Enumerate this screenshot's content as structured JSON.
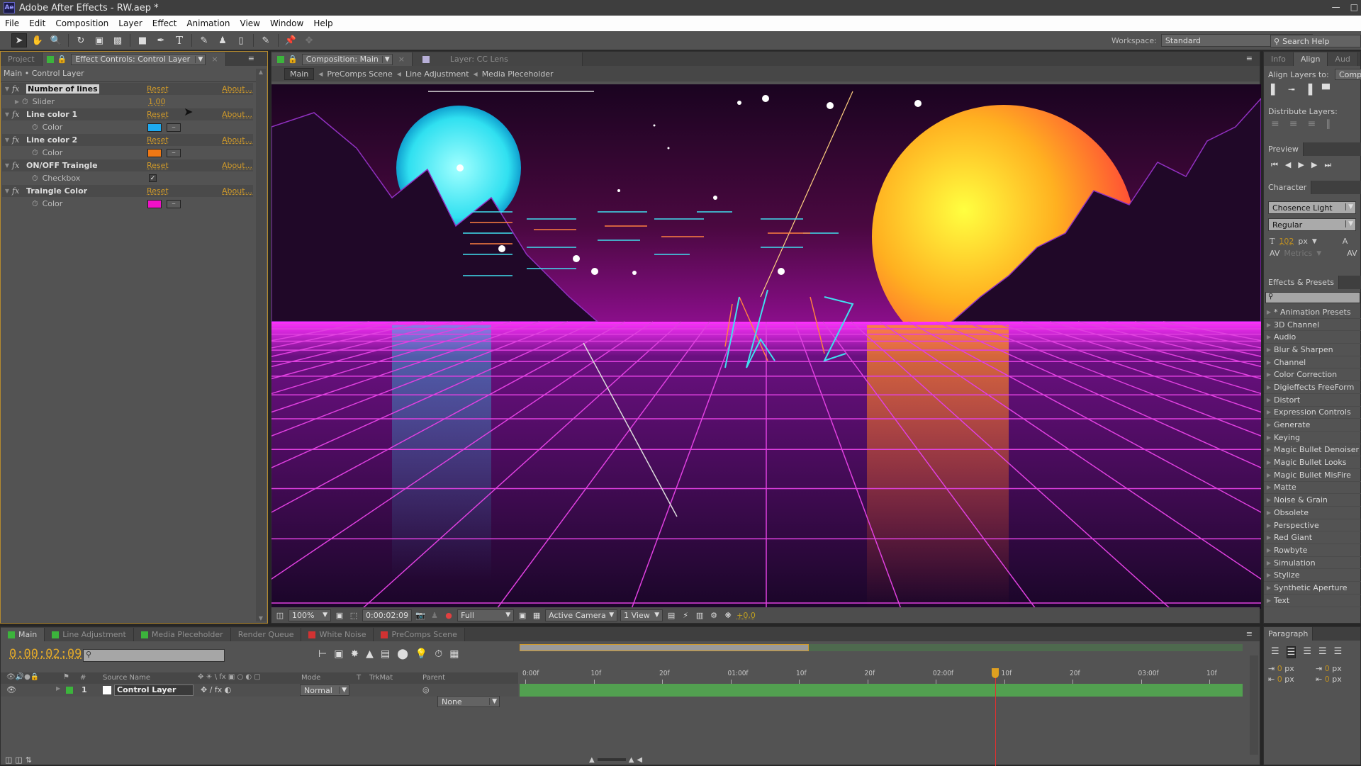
{
  "app": {
    "title": "Adobe After Effects - RW.aep *",
    "logo": "Ae"
  },
  "menu": [
    "File",
    "Edit",
    "Composition",
    "Layer",
    "Effect",
    "Animation",
    "View",
    "Window",
    "Help"
  ],
  "workspace": {
    "label": "Workspace:",
    "value": "Standard"
  },
  "search_help": {
    "placeholder": "Search Help"
  },
  "effect_controls": {
    "tabs": {
      "project": "Project",
      "effect": "Effect Controls: Control Layer"
    },
    "header": "Main • Control Layer",
    "reset_label": "Reset",
    "about_label": "About...",
    "effects": [
      {
        "name": "Number of lines",
        "prop": "Slider",
        "value": "1,00",
        "type": "slider"
      },
      {
        "name": "Line color 1",
        "prop": "Color",
        "color": "#1eaaf0",
        "type": "color"
      },
      {
        "name": "Line color 2",
        "prop": "Color",
        "color": "#f07814",
        "type": "color"
      },
      {
        "name": "ON/OFF Traingle",
        "prop": "Checkbox",
        "checked": true,
        "type": "checkbox"
      },
      {
        "name": "Traingle Color",
        "prop": "Color",
        "color": "#f010c8",
        "type": "color"
      }
    ]
  },
  "composition": {
    "tab": "Composition: Main",
    "layer_tab": "Layer: CC Lens",
    "breadcrumbs": [
      "Main",
      "PreComps Scene",
      "Line Adjustment",
      "Media Pleceholder"
    ],
    "zoom": "100%",
    "timecode": "0:00:02:09",
    "resolution": "Full",
    "camera": "Active Camera",
    "views": "1 View",
    "exposure": "+0,0"
  },
  "right_panels": {
    "tabs": [
      "Info",
      "Align",
      "Aud"
    ],
    "align_layers_to": "Align Layers to:",
    "align_target": "Comp",
    "distribute_layers": "Distribute Layers:",
    "preview": "Preview",
    "character": "Character",
    "font": "Chosence Light",
    "style": "Regular",
    "font_size": "102",
    "font_unit": "px",
    "kerning": "Metrics",
    "effects_presets": "Effects & Presets",
    "effects_list": [
      "* Animation Presets",
      "3D Channel",
      "Audio",
      "Blur & Sharpen",
      "Channel",
      "Color Correction",
      "Digieffects FreeForm",
      "Distort",
      "Expression Controls",
      "Generate",
      "Keying",
      "Magic Bullet Denoiser",
      "Magic Bullet Looks",
      "Magic Bullet MisFire",
      "Matte",
      "Noise & Grain",
      "Obsolete",
      "Perspective",
      "Red Giant",
      "Rowbyte",
      "Simulation",
      "Stylize",
      "Synthetic Aperture",
      "Text"
    ]
  },
  "timeline": {
    "tabs": [
      {
        "label": "Main",
        "color": "#3cb43c",
        "active": true
      },
      {
        "label": "Line Adjustment",
        "color": "#3cb43c"
      },
      {
        "label": "Media Pleceholder",
        "color": "#3cb43c"
      },
      {
        "label": "Render Queue",
        "color": ""
      },
      {
        "label": "White Noise",
        "color": "#d23232"
      },
      {
        "label": "PreComps Scene",
        "color": "#d23232"
      }
    ],
    "timecode": "0:00:02:09",
    "columns": {
      "hash": "#",
      "source": "Source Name",
      "mode": "Mode",
      "t": "T",
      "trkmat": "TrkMat",
      "parent": "Parent"
    },
    "layers": [
      {
        "index": "1",
        "name": "Control Layer",
        "mode": "Normal",
        "parent": "None"
      }
    ],
    "ruler": [
      "0:00f",
      "10f",
      "20f",
      "01:00f",
      "10f",
      "20f",
      "02:00f",
      "10f",
      "20f",
      "03:00f",
      "10f"
    ],
    "playhead_label": "10f",
    "work_area_end_fraction": 0.4,
    "playhead_fraction": 0.654
  },
  "paragraph": {
    "title": "Paragraph",
    "indent_values": [
      "0",
      "0",
      "0",
      "0"
    ],
    "unit": "px"
  }
}
